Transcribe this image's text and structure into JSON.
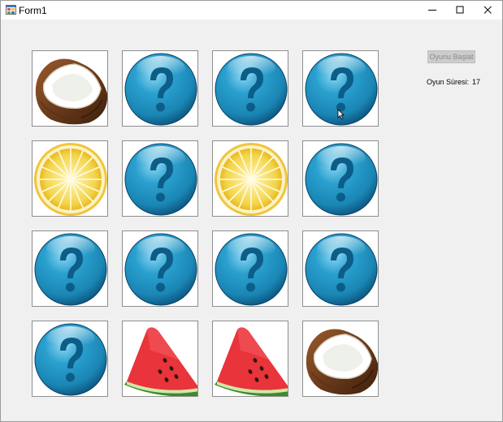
{
  "window": {
    "title": "Form1",
    "controls": [
      "minimize-icon",
      "maximize-icon",
      "close-icon"
    ]
  },
  "game": {
    "start_button_label": "Oyunu Başlat",
    "start_button_enabled": false,
    "time_label": "Oyun Süresi:",
    "time_value": "17",
    "grid": [
      [
        "coconut",
        "hidden",
        "hidden",
        "hidden"
      ],
      [
        "lemon",
        "hidden",
        "lemon",
        "hidden"
      ],
      [
        "hidden",
        "hidden",
        "hidden",
        "hidden"
      ],
      [
        "hidden",
        "watermelon",
        "watermelon",
        "coconut"
      ]
    ]
  },
  "colors": {
    "question_orb": "#1a86b4",
    "window_bg": "#f0f0f0"
  }
}
